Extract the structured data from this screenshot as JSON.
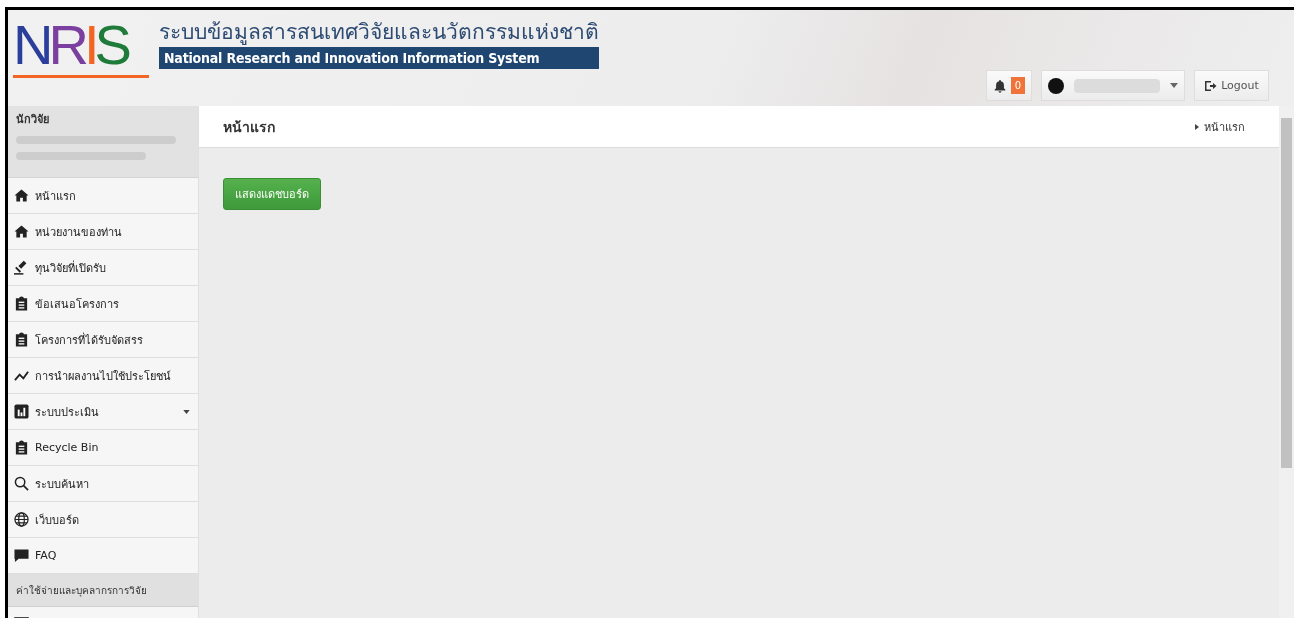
{
  "header": {
    "logo": "NRIS",
    "title_th": "ระบบข้อมูลสารสนเทศวิจัยและนวัตกรรมแห่งชาติ",
    "title_en": "National Research and Innovation Information System",
    "notifications": "0",
    "logout": "Logout"
  },
  "sidebar": {
    "section_title": "นักวิจัย",
    "items": [
      {
        "label": "หน้าแรก",
        "kind": "home",
        "expandable": false
      },
      {
        "label": "หน่วยงานของท่าน",
        "kind": "home",
        "expandable": false
      },
      {
        "label": "ทุนวิจัยที่เปิดรับ",
        "kind": "gavel",
        "expandable": false
      },
      {
        "label": "ข้อเสนอโครงการ",
        "kind": "clipboard",
        "expandable": false
      },
      {
        "label": "โครงการที่ได้รับจัดสรร",
        "kind": "clipboard",
        "expandable": false
      },
      {
        "label": "การนำผลงานไปใช้ประโยชน์",
        "kind": "line",
        "expandable": false
      },
      {
        "label": "ระบบประเมิน",
        "kind": "chart",
        "expandable": true
      },
      {
        "label": "Recycle Bin",
        "kind": "clipboard",
        "expandable": false
      },
      {
        "label": "ระบบค้นหา",
        "kind": "search",
        "expandable": false
      },
      {
        "label": "เว็บบอร์ด",
        "kind": "globe",
        "expandable": false
      },
      {
        "label": "FAQ",
        "kind": "comment",
        "expandable": false
      }
    ],
    "group_title": "ค่าใช้จ่ายและบุคลากรการวิจัย"
  },
  "main": {
    "title": "หน้าแรก",
    "breadcrumb": "หน้าแรก",
    "dashboard_button": "แสดงแดชบอร์ด"
  }
}
